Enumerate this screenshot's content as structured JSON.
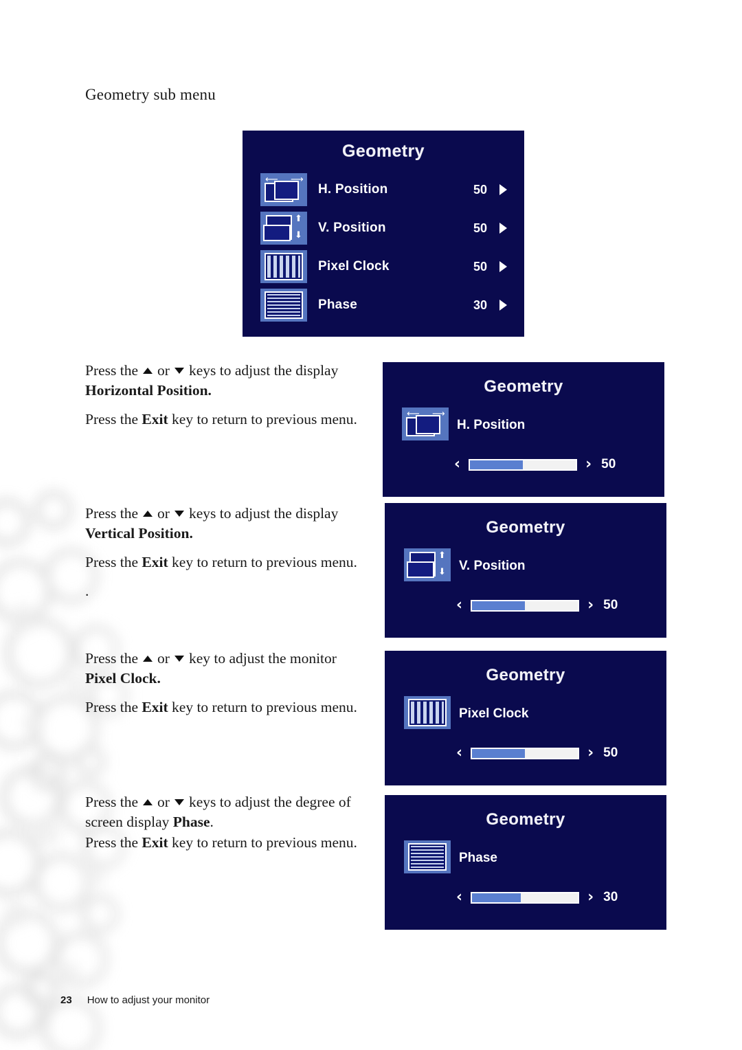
{
  "document": {
    "section_title": "Geometry sub menu",
    "footer": {
      "page_number": "23",
      "running_head": "How to adjust your monitor"
    }
  },
  "colors": {
    "osd_background": "#0a0a4e",
    "osd_icon_tile": "#5575bf",
    "slider_fill": "#5a7fd0",
    "slider_track": "#f2f2f2",
    "osd_text": "#ffffff"
  },
  "main_menu": {
    "title": "Geometry",
    "rows": [
      {
        "icon": "h-position-icon",
        "label": "H. Position",
        "value": "50",
        "arrow": "right-triangle-icon"
      },
      {
        "icon": "v-position-icon",
        "label": "V. Position",
        "value": "50",
        "arrow": "right-triangle-icon"
      },
      {
        "icon": "pixel-clock-icon",
        "label": "Pixel Clock",
        "value": "50",
        "arrow": "right-triangle-icon"
      },
      {
        "icon": "phase-icon",
        "label": "Phase",
        "value": "30",
        "arrow": "right-triangle-icon"
      }
    ]
  },
  "adjust_panels": [
    {
      "id": "h-position",
      "title": "Geometry",
      "icon": "h-position-icon",
      "label": "H. Position",
      "value": "50",
      "fill_percent": 50,
      "left_chevron": "‹",
      "right_chevron": "›"
    },
    {
      "id": "v-position",
      "title": "Geometry",
      "icon": "v-position-icon",
      "label": "V. Position",
      "value": "50",
      "fill_percent": 50,
      "left_chevron": "‹",
      "right_chevron": "›"
    },
    {
      "id": "pixel-clock",
      "title": "Geometry",
      "icon": "pixel-clock-icon",
      "label": "Pixel Clock",
      "value": "50",
      "fill_percent": 50,
      "left_chevron": "‹",
      "right_chevron": "›"
    },
    {
      "id": "phase",
      "title": "Geometry",
      "icon": "phase-icon",
      "label": "Phase",
      "value": "30",
      "fill_percent": 46,
      "left_chevron": "‹",
      "right_chevron": "›"
    }
  ],
  "instructions": {
    "h_position": {
      "lead": "Press the",
      "or": "or",
      "tail": "keys to adjust the display",
      "subject": "Horizontal Position.",
      "exit_pre": "Press the ",
      "exit_key": "Exit",
      "exit_post": " key to return to previous menu."
    },
    "v_position": {
      "lead": "Press the",
      "or": "or",
      "tail": "keys to adjust the display",
      "subject": "Vertical Position.",
      "exit_pre": "Press the ",
      "exit_key": "Exit",
      "exit_post": " key to return to previous menu.",
      "stray_period": "."
    },
    "pixel_clock": {
      "lead": "Press the",
      "or": "or",
      "tail": "key to adjust the monitor",
      "subject": "Pixel Clock.",
      "exit_pre": "Press the ",
      "exit_key": "Exit",
      "exit_post": " key to return to previous menu."
    },
    "phase": {
      "lead": "Press the",
      "or": "or",
      "tail": "keys to adjust the degree of",
      "subject_pre": "screen display ",
      "subject_key": "Phase",
      "subject_post": ".",
      "exit_pre": "Press the ",
      "exit_key": "Exit",
      "exit_post": " key to return to previous menu."
    }
  }
}
